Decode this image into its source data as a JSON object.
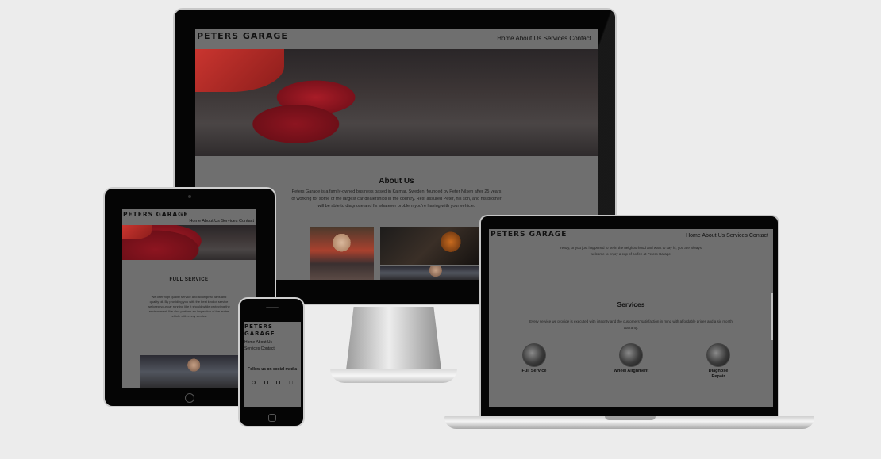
{
  "site": {
    "brand": "PETERS GARAGE",
    "brand_line1": "PETERS",
    "brand_line2": "GARAGE",
    "nav": [
      "Home",
      "About Us",
      "Services",
      "Contact"
    ]
  },
  "desktop": {
    "about_title": "About Us",
    "about_text": "Peters Garage is a family-owned business based in Kalmar, Sweden, founded by Peter Nilsen after 25 years of working for some of the largest car dealerships in the country. Rest assured Peter, his son, and his brother will be able to diagnose and fix whatever problem you're having with your vehicle."
  },
  "tablet": {
    "service_title": "FULL SERVICE",
    "service_text": "We offer high quality service and all original parts and quality oil. By providing you with the best kind of service we keep your car running like it should while protecting the environment. We also perform an inspection of the entire vehicle with every service."
  },
  "phone": {
    "social_title": "Follow us on social media",
    "social_icons": [
      "facebook-icon",
      "instagram-icon",
      "twitter-icon",
      "youtube-icon"
    ]
  },
  "laptop": {
    "intro_text": "ready, or you just happened to be in the neighborhood and want to say hi, you are always welcome to enjoy a cup of coffee at Peters Garage.",
    "services_title": "Services",
    "services_text": "Every service we provide is executed with integrity and the customers' satisfaction in mind with affordable prices and a six month warranty.",
    "services": [
      {
        "label": "Full Service"
      },
      {
        "label": "Wheel Alignment"
      },
      {
        "label": "Diagnose Repair"
      }
    ]
  },
  "colors": {
    "page_bg": "#ececec",
    "site_bg": "#6f6f6f",
    "bezel": "#050505"
  }
}
